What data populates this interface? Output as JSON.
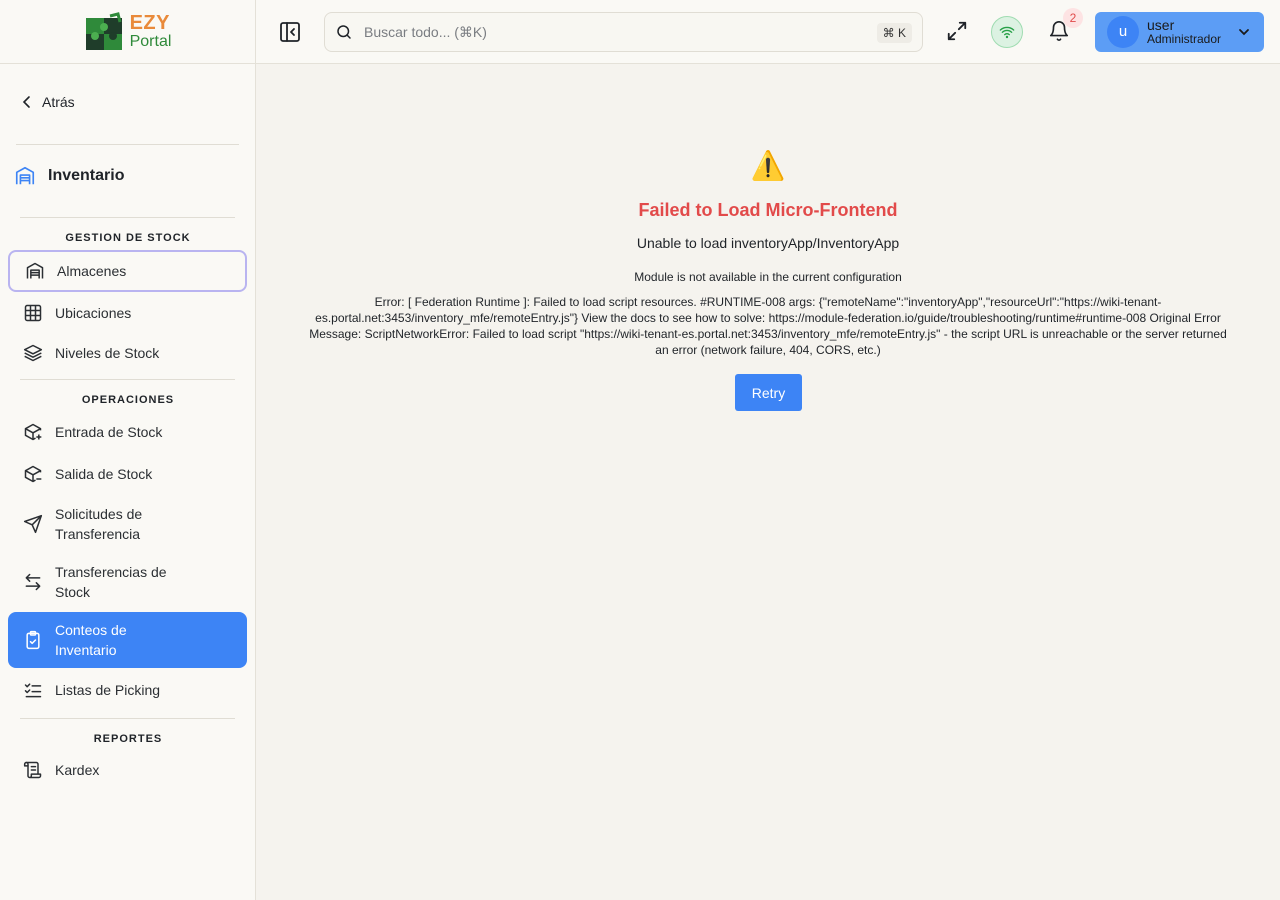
{
  "logo": {
    "line1": "EZY",
    "line2": "Portal"
  },
  "sidebar": {
    "back_label": "Atrás",
    "module_title": "Inventario",
    "sections": {
      "stock": "GESTION DE STOCK",
      "ops": "OPERACIONES",
      "reports": "REPORTES"
    },
    "items": [
      {
        "label": "Almacenes",
        "icon": "warehouse-icon",
        "state": "outlined"
      },
      {
        "label": "Ubicaciones",
        "icon": "grid-icon"
      },
      {
        "label": "Niveles de Stock",
        "icon": "layers-icon"
      },
      {
        "label": "Entrada de Stock",
        "icon": "package-plus-icon"
      },
      {
        "label": "Salida de Stock",
        "icon": "package-minus-icon"
      },
      {
        "label": "Solicitudes de Transferencia",
        "icon": "send-icon"
      },
      {
        "label": "Transferencias de Stock",
        "icon": "arrows-left-right-icon"
      },
      {
        "label": "Conteos de Inventario",
        "icon": "clipboard-check-icon",
        "state": "active"
      },
      {
        "label": "Listas de Picking",
        "icon": "list-checks-icon"
      },
      {
        "label": "Kardex",
        "icon": "scroll-icon"
      }
    ]
  },
  "topbar": {
    "search_placeholder": "Buscar todo... (⌘K)",
    "shortcut": "⌘ K",
    "notifications_count": "2",
    "user": {
      "initial": "u",
      "name": "user",
      "role": "Administrador"
    }
  },
  "error": {
    "icon": "⚠️",
    "title": "Failed to Load Micro-Frontend",
    "subtitle": "Unable to load inventoryApp/InventoryApp",
    "message": "Module is not available in the current configuration",
    "detail": "Error: [ Federation Runtime ]: Failed to load script resources. #RUNTIME-008 args: {\"remoteName\":\"inventoryApp\",\"resourceUrl\":\"https://wiki-tenant-es.portal.net:3453/inventory_mfe/remoteEntry.js\"} View the docs to see how to solve: https://module-federation.io/guide/troubleshooting/runtime#runtime-008 Original Error Message: ScriptNetworkError: Failed to load script \"https://wiki-tenant-es.portal.net:3453/inventory_mfe/remoteEntry.js\" - the script URL is unreachable or the server returned an error (network failure, 404, CORS, etc.)",
    "retry_label": "Retry"
  },
  "colors": {
    "accent": "#3d84f5",
    "error": "#e24a4a",
    "badge_bg": "#fde3e3",
    "status_ok": "#dcf2e2"
  }
}
